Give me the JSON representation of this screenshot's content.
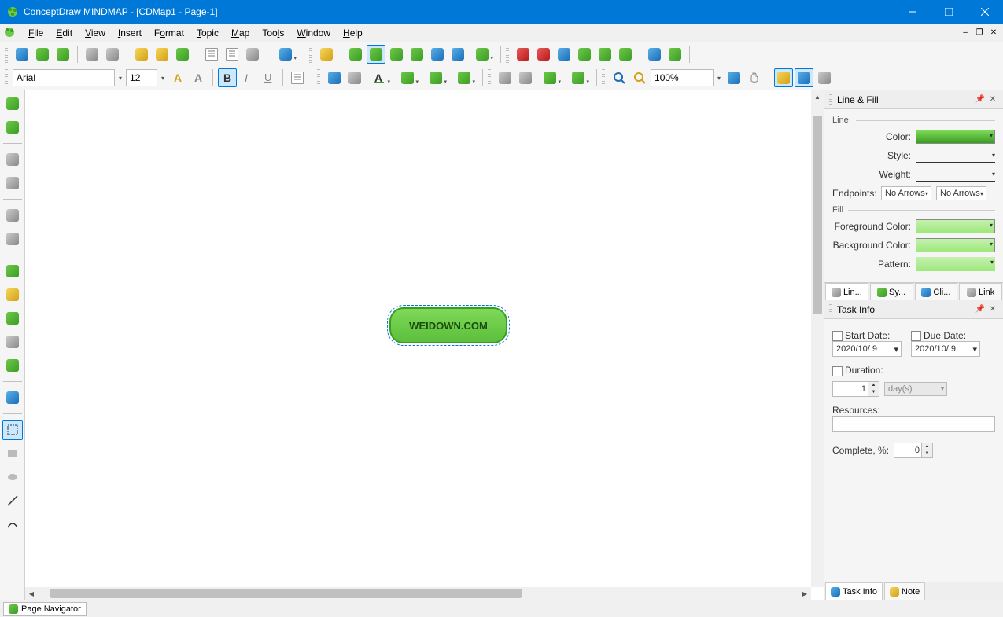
{
  "titlebar": {
    "title": "ConceptDraw MINDMAP - [CDMap1 - Page-1]"
  },
  "menu": {
    "items": [
      "File",
      "Edit",
      "View",
      "Insert",
      "Format",
      "Topic",
      "Map",
      "Tools",
      "Window",
      "Help"
    ]
  },
  "toolbar2": {
    "font": "Arial",
    "size": "12",
    "zoom": "100%"
  },
  "canvas": {
    "topic_text": "WEIDOWN.COM"
  },
  "linefill": {
    "title": "Line & Fill",
    "line_group": "Line",
    "fill_group": "Fill",
    "color_label": "Color:",
    "style_label": "Style:",
    "weight_label": "Weight:",
    "endpoints_label": "Endpoints:",
    "endpoint1": "No Arrows",
    "endpoint2": "No Arrows",
    "fg_label": "Foreground Color:",
    "bg_label": "Background Color:",
    "pattern_label": "Pattern:",
    "tabs": [
      "Lin...",
      "Sy...",
      "Cli...",
      "Link"
    ]
  },
  "taskinfo": {
    "title": "Task Info",
    "start_label": "Start Date:",
    "due_label": "Due Date:",
    "start_val": "2020/10/ 9",
    "due_val": "2020/10/ 9",
    "duration_label": "Duration:",
    "duration_val": "1",
    "duration_unit": "day(s)",
    "resources_label": "Resources:",
    "complete_label": "Complete, %:",
    "complete_val": "0",
    "bottom_tabs": [
      "Task Info",
      "Note"
    ]
  },
  "statusbar": {
    "page_nav": "Page Navigator"
  }
}
